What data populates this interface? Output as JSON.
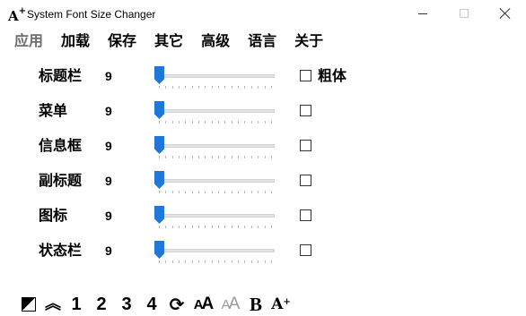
{
  "window": {
    "title": "System Font Size Changer",
    "app_icon": "A",
    "app_icon_sup": "+"
  },
  "menu": [
    {
      "label": "应用",
      "dim": true
    },
    {
      "label": "加载"
    },
    {
      "label": "保存"
    },
    {
      "label": "其它"
    },
    {
      "label": "高级"
    },
    {
      "label": "语言"
    },
    {
      "label": "关于"
    }
  ],
  "rows": [
    {
      "label": "标题栏",
      "value": "9",
      "slider_fraction": 0,
      "bold_checked": false
    },
    {
      "label": "菜单",
      "value": "9",
      "slider_fraction": 0,
      "bold_checked": false
    },
    {
      "label": "信息框",
      "value": "9",
      "slider_fraction": 0,
      "bold_checked": false
    },
    {
      "label": "副标题",
      "value": "9",
      "slider_fraction": 0,
      "bold_checked": false
    },
    {
      "label": "图标",
      "value": "9",
      "slider_fraction": 0,
      "bold_checked": false
    },
    {
      "label": "状态栏",
      "value": "9",
      "slider_fraction": 0,
      "bold_checked": false
    }
  ],
  "bold_label": "粗体",
  "toolbar": {
    "icons": [
      "contrast-icon",
      "chevron-up-icon",
      "refresh-icon",
      "font-size-icon",
      "font-size-grey-icon",
      "bold-icon",
      "font-increase-icon"
    ],
    "preset_1": "1",
    "preset_2": "2",
    "preset_3": "3",
    "preset_4": "4",
    "chevron": "︽",
    "refresh": "⟳",
    "aa_small": "A",
    "aa_big": "A",
    "bold": "B",
    "aplus": "A",
    "aplus_sup": "+"
  },
  "colors": {
    "slider_thumb": "#1e78d7",
    "menu_dim": "#6d6d6d"
  }
}
